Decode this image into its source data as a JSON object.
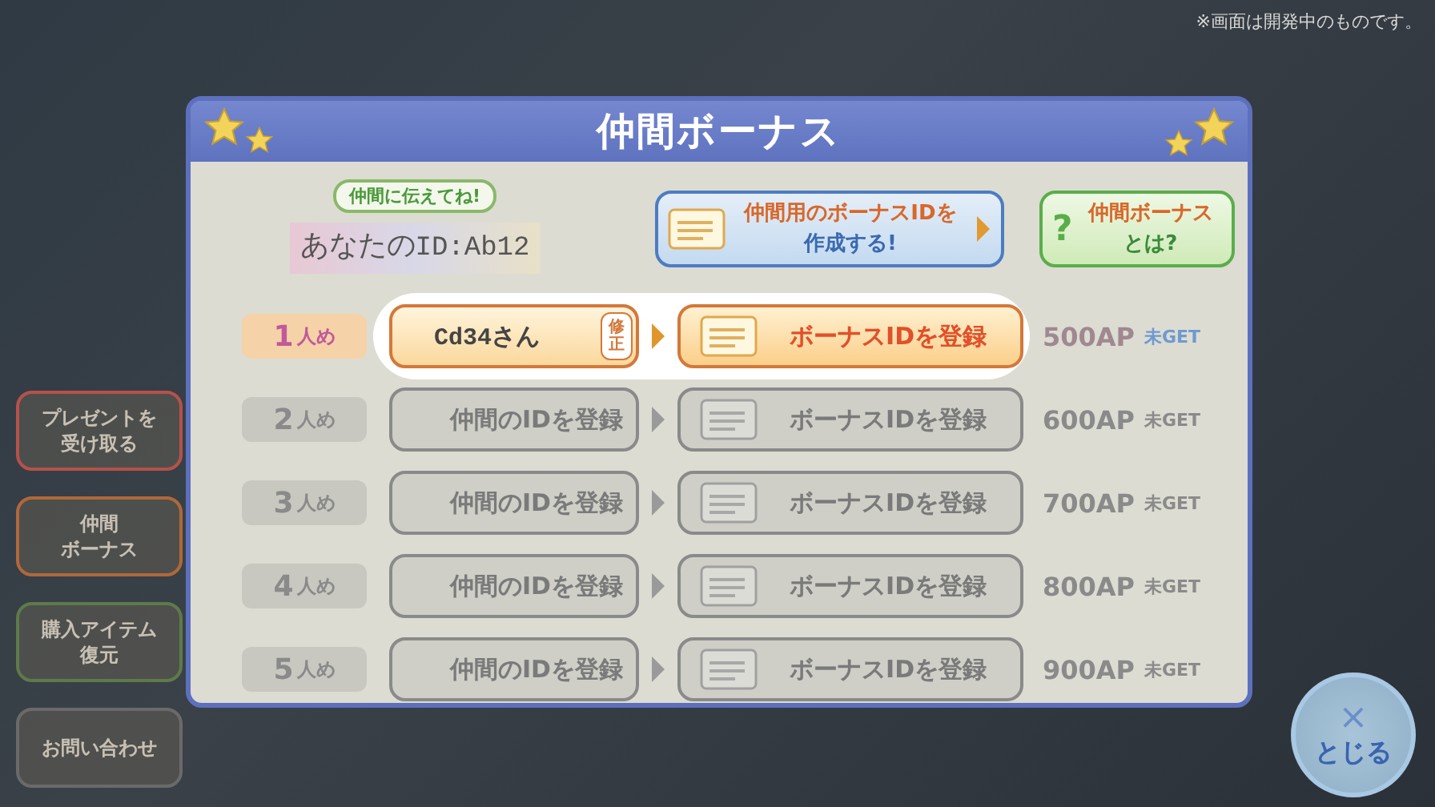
{
  "notice": "※画面は開発中のものです。",
  "side_menu": [
    {
      "lines": [
        "プレゼントを",
        "受け取る"
      ],
      "color": "#b5524a"
    },
    {
      "lines": [
        "仲間",
        "ボーナス"
      ],
      "color": "#b0683a"
    },
    {
      "lines": [
        "購入アイテム",
        "復元"
      ],
      "color": "#5e7a4a"
    },
    {
      "lines": [
        "お問い合わせ"
      ],
      "color": "#6a6a6a"
    }
  ],
  "dialog": {
    "title": "仲間ボーナス",
    "hint": "仲間に伝えてね!",
    "your_id_label": "あなたの",
    "your_id": "ID:Ab12",
    "create_button": [
      "仲間用のボーナスIDを",
      "作成する!"
    ],
    "help_button": {
      "icon": "?",
      "lines": [
        "仲間ボーナス",
        "とは?"
      ]
    },
    "rows": [
      {
        "number": "1",
        "suffix": "人め",
        "friend": "Cd34さん",
        "edit": "修正",
        "register": "ボーナスIDを登録",
        "reward": "500AP",
        "status": "未GET",
        "active": true
      },
      {
        "number": "2",
        "suffix": "人め",
        "friend": "仲間のIDを登録",
        "register": "ボーナスIDを登録",
        "reward": "600AP",
        "status": "未GET",
        "active": false
      },
      {
        "number": "3",
        "suffix": "人め",
        "friend": "仲間のIDを登録",
        "register": "ボーナスIDを登録",
        "reward": "700AP",
        "status": "未GET",
        "active": false
      },
      {
        "number": "4",
        "suffix": "人め",
        "friend": "仲間のIDを登録",
        "register": "ボーナスIDを登録",
        "reward": "800AP",
        "status": "未GET",
        "active": false
      },
      {
        "number": "5",
        "suffix": "人め",
        "friend": "仲間のIDを登録",
        "register": "ボーナスIDを登録",
        "reward": "900AP",
        "status": "未GET",
        "active": false
      }
    ]
  },
  "close_button": {
    "icon": "×",
    "label": "とじる"
  }
}
